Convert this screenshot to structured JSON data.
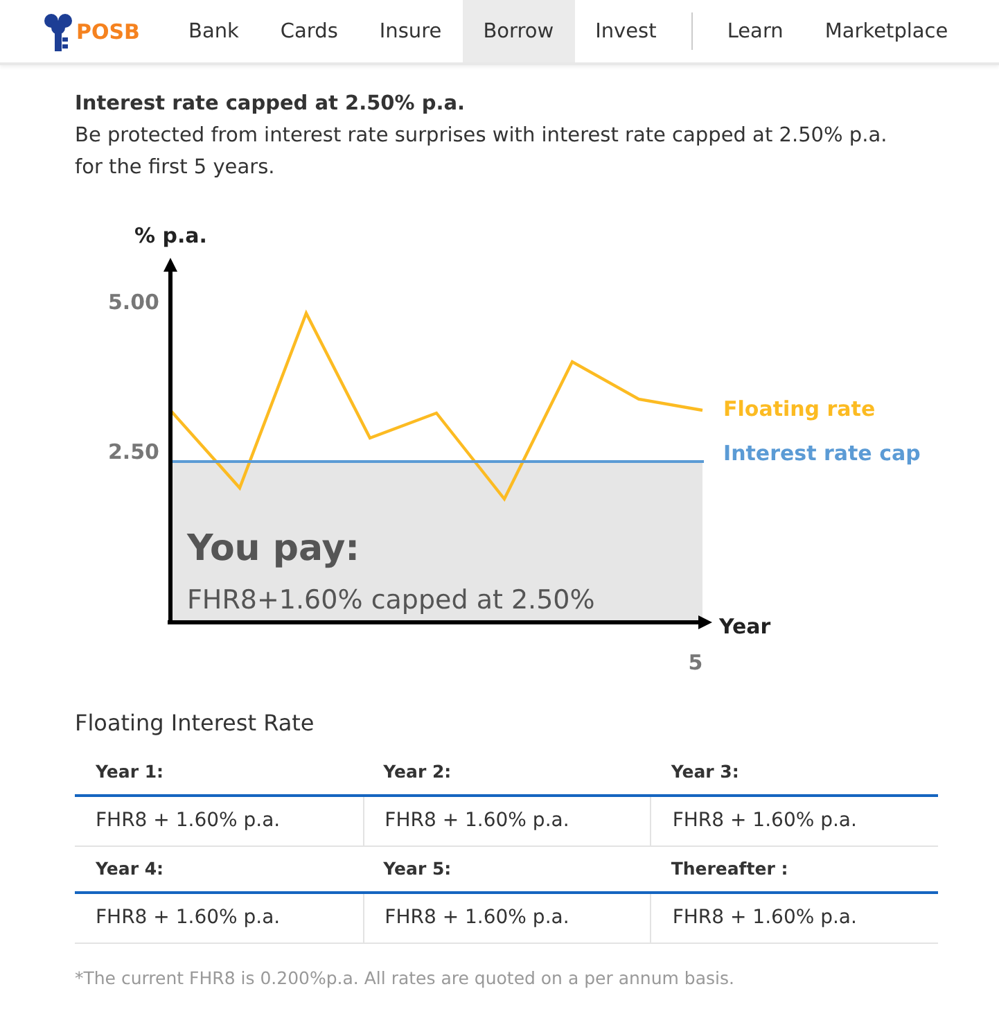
{
  "nav": {
    "logo": "POSB",
    "primary": [
      {
        "label": "Bank",
        "selected": false
      },
      {
        "label": "Cards",
        "selected": false
      },
      {
        "label": "Insure",
        "selected": false
      },
      {
        "label": "Borrow",
        "selected": true
      },
      {
        "label": "Invest",
        "selected": false
      }
    ],
    "secondary": [
      {
        "label": "Learn",
        "selected": false
      },
      {
        "label": "Marketplace",
        "selected": false
      }
    ]
  },
  "intro": {
    "title": "Interest rate capped at 2.50% p.a.",
    "body": "Be protected from interest rate surprises with interest rate capped at 2.50% p.a. for the first 5 years."
  },
  "chart": {
    "y_label": "% p.a.",
    "y_ticks": [
      "5.00",
      "2.50"
    ],
    "x_label": "Year",
    "x_tick": "5",
    "legend": [
      {
        "label": "Floating rate",
        "kind": "floating"
      },
      {
        "label": "Interest rate cap",
        "kind": "cap"
      }
    ],
    "note_title": "You pay:",
    "note_text": "FHR8+1.60% capped at 2.50%"
  },
  "rates": {
    "title": "Floating Interest Rate",
    "groups": [
      {
        "cells": [
          {
            "label": "Year 1:",
            "value": "FHR8 + 1.60% p.a."
          },
          {
            "label": "Year 2:",
            "value": "FHR8 + 1.60% p.a."
          },
          {
            "label": "Year 3:",
            "value": "FHR8 + 1.60% p.a."
          }
        ]
      },
      {
        "cells": [
          {
            "label": "Year 4:",
            "value": "FHR8 + 1.60% p.a."
          },
          {
            "label": "Year 5:",
            "value": "FHR8 + 1.60% p.a."
          },
          {
            "label": "Thereafter :",
            "value": "FHR8 + 1.60% p.a."
          }
        ]
      }
    ]
  },
  "footnote": "*The current FHR8 is 0.200%p.a. All rates are quoted on a per annum basis."
}
